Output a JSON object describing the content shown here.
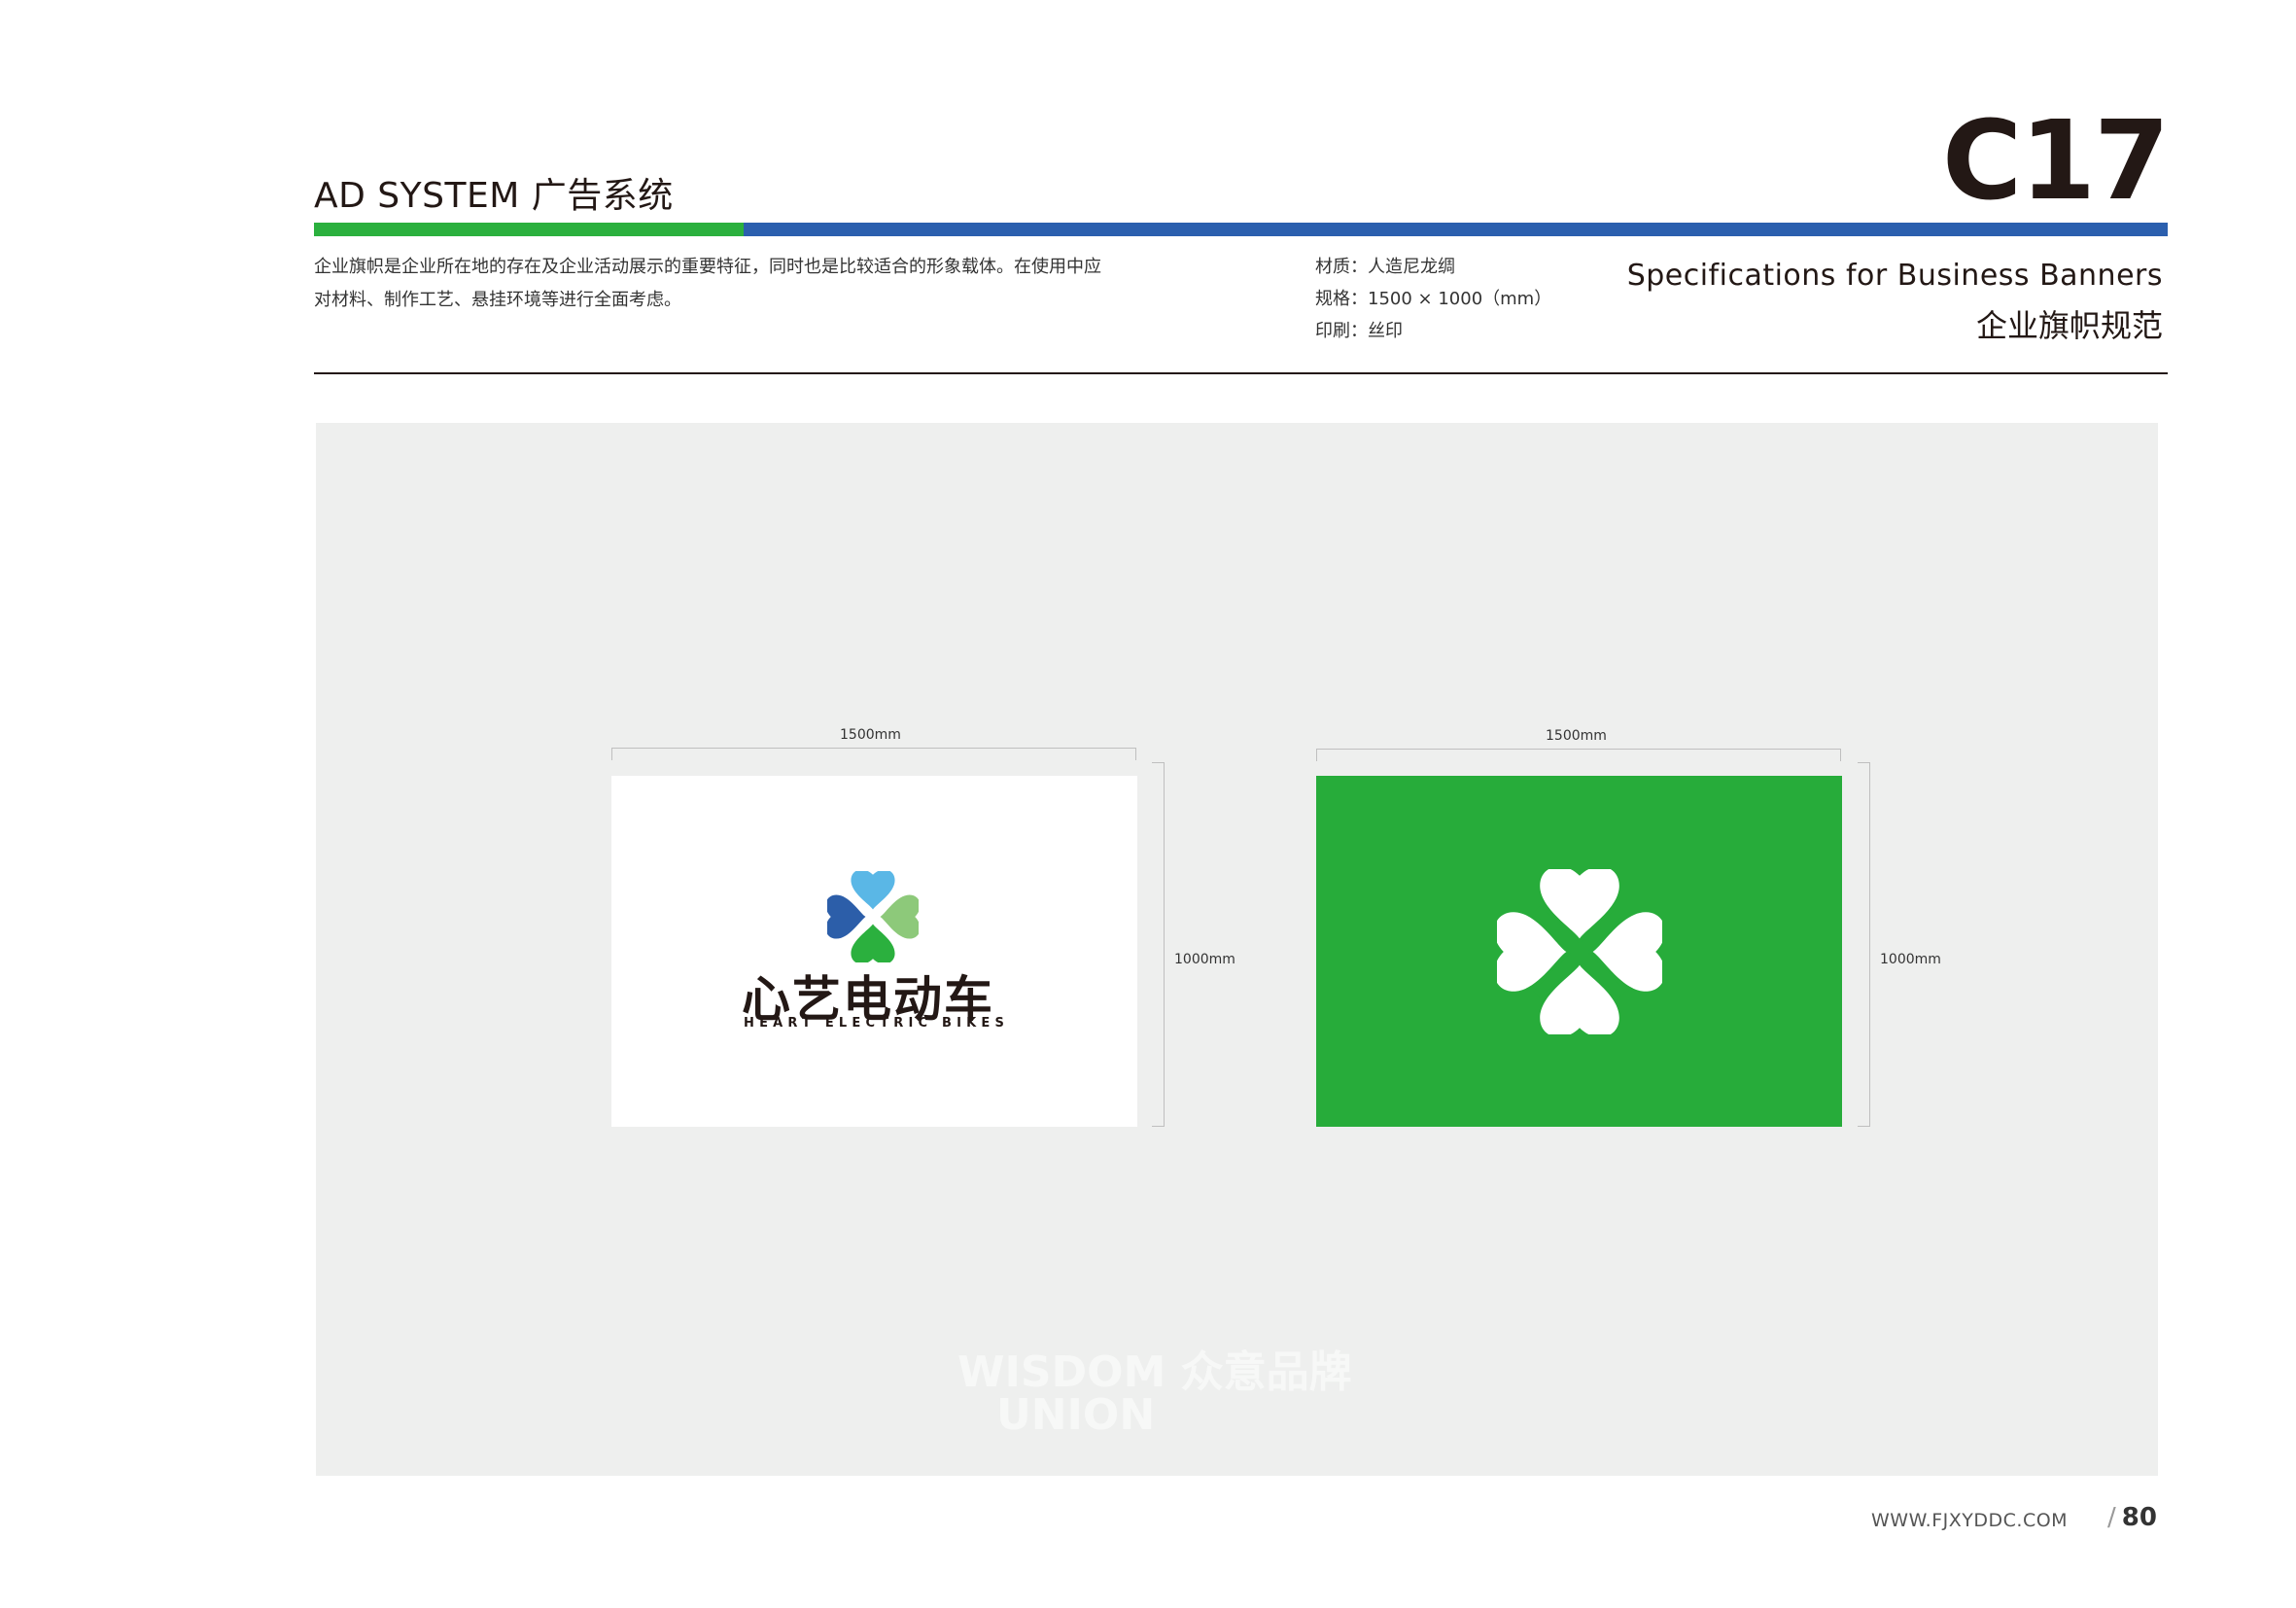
{
  "header": {
    "section_title": "AD SYSTEM 广告系统",
    "page_code": "C17",
    "description_line1": "企业旗帜是企业所在地的存在及企业活动展示的重要特征，同时也是比较适合的形象载体。在使用中应",
    "description_line2": "对材料、制作工艺、悬挂环境等进行全面考虑。",
    "spec_material": "材质：人造尼龙绸",
    "spec_size": "规格：1500 × 1000（mm）",
    "spec_print": "印刷：丝印",
    "title_en": "Specifications for  Business Banners",
    "title_cn": "企业旗帜规范"
  },
  "flags": {
    "white": {
      "width_label": "1500mm",
      "height_label": "1000mm"
    },
    "green": {
      "width_label": "1500mm",
      "height_label": "1000mm"
    }
  },
  "logo": {
    "name_cn": "心艺电动车",
    "name_en": "HEART ELECTRIC BIKES",
    "colors": {
      "blue_dark": "#2c5ea9",
      "blue_light": "#5ab7e6",
      "green_light": "#8dc97a",
      "green": "#2bb03e"
    }
  },
  "watermark": {
    "line1": "WISDOM 众意品牌",
    "line2": "UNION"
  },
  "footer": {
    "url": "WWW.FJXYDDC.COM",
    "slash": "/",
    "page_number": "80"
  },
  "colors": {
    "brand_green": "#27ac3a",
    "brand_blue": "#2b5fae",
    "panel": "#eeefee"
  }
}
